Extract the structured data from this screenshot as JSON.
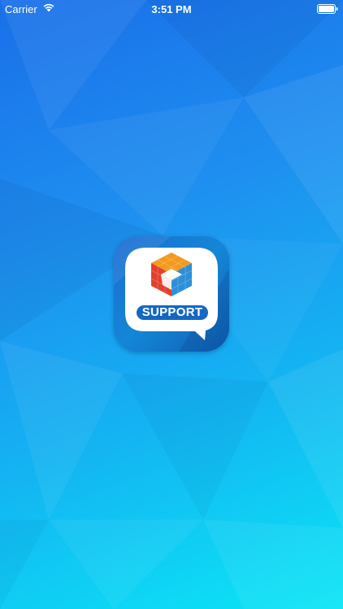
{
  "status_bar": {
    "carrier": "Carrier",
    "time": "3:51 PM",
    "wifi_icon": "wifi-icon",
    "battery_icon": "battery-icon"
  },
  "splash": {
    "app_icon": "support-app-icon",
    "badge_text": "SUPPORT"
  },
  "colors": {
    "background_top": "#1a6fe8",
    "background_bottom": "#0be6f6",
    "icon_blue": "#1468c4",
    "cube_orange": "#f39a1e",
    "cube_red": "#e2412b",
    "cube_blue": "#2d8fd8"
  }
}
